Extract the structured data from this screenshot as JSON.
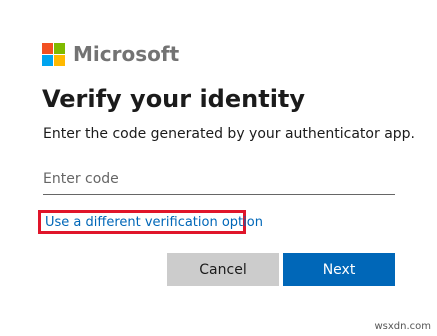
{
  "brand": {
    "name": "Microsoft",
    "colors": {
      "red": "#f25022",
      "green": "#7fba00",
      "blue": "#00a4ef",
      "yellow": "#ffb900"
    }
  },
  "title": "Verify your identity",
  "subtitle": "Enter the code generated by your authenticator app.",
  "code_input": {
    "value": "",
    "placeholder": "Enter code"
  },
  "alt_option_link": "Use a different verification option",
  "highlight_color": "#e0152a",
  "buttons": {
    "cancel_label": "Cancel",
    "next_label": "Next"
  },
  "accent_color": "#0067b8",
  "watermark": "wsxdn.com"
}
